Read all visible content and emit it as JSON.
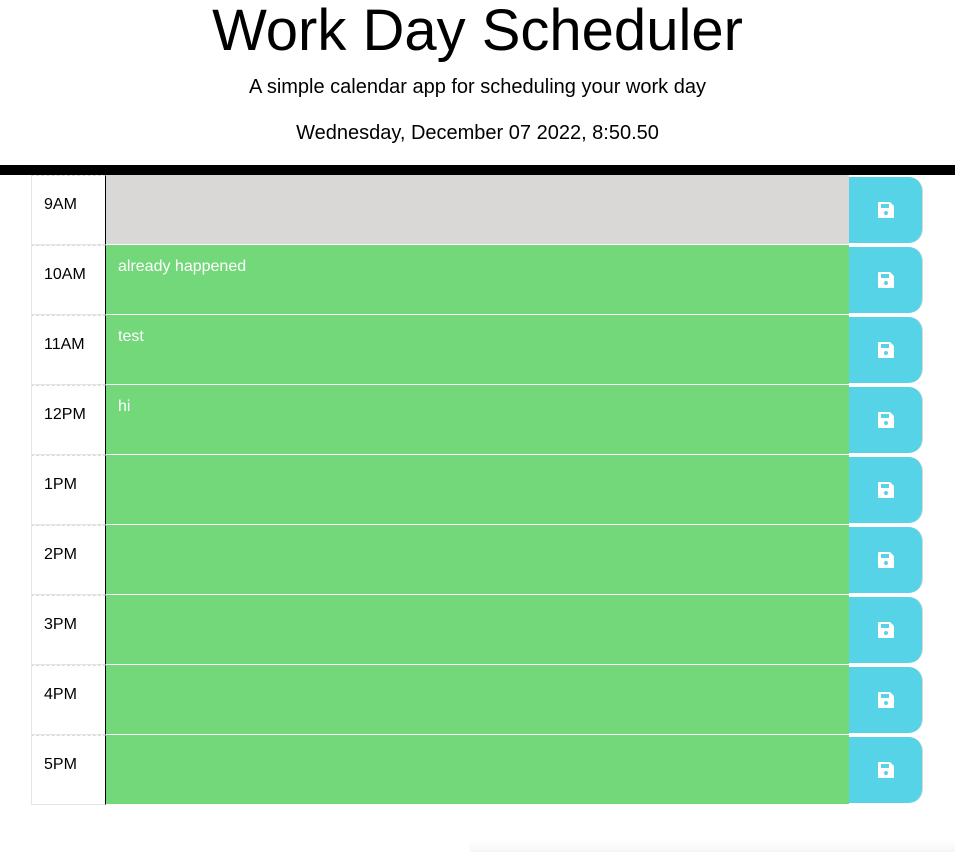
{
  "header": {
    "title": "Work Day Scheduler",
    "subtitle": "A simple calendar app for scheduling your work day",
    "current_day": "Wednesday, December 07 2022, 8:50.50"
  },
  "colors": {
    "past": "#d9d8d7",
    "future": "#73d879",
    "save_button": "#57d3e8",
    "divider": "#000000"
  },
  "time_blocks": [
    {
      "hour": "9AM",
      "text": "",
      "state": "past",
      "save_icon": "floppy-disk-icon"
    },
    {
      "hour": "10AM",
      "text": "already happened",
      "state": "future",
      "save_icon": "floppy-disk-icon"
    },
    {
      "hour": "11AM",
      "text": "test",
      "state": "future",
      "save_icon": "floppy-disk-icon"
    },
    {
      "hour": "12PM",
      "text": "hi",
      "state": "future",
      "save_icon": "floppy-disk-icon"
    },
    {
      "hour": "1PM",
      "text": "",
      "state": "future",
      "save_icon": "floppy-disk-icon"
    },
    {
      "hour": "2PM",
      "text": "",
      "state": "future",
      "save_icon": "floppy-disk-icon"
    },
    {
      "hour": "3PM",
      "text": "",
      "state": "future",
      "save_icon": "floppy-disk-icon"
    },
    {
      "hour": "4PM",
      "text": "",
      "state": "future",
      "save_icon": "floppy-disk-icon"
    },
    {
      "hour": "5PM",
      "text": "",
      "state": "future",
      "save_icon": "floppy-disk-icon"
    }
  ]
}
